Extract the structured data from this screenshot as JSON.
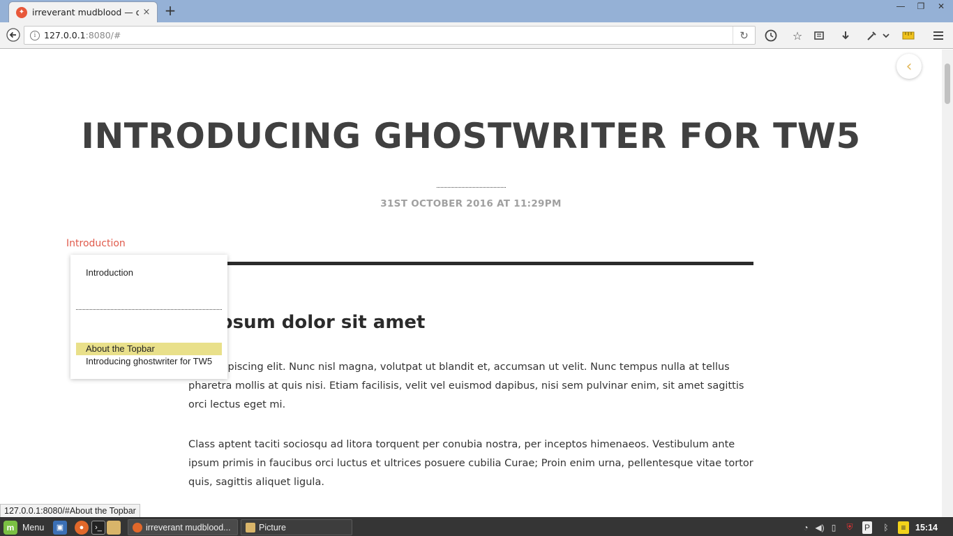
{
  "browser": {
    "tab_title": "irreverant mudblood — o...",
    "tab_close": "×",
    "new_tab": "+",
    "url_host": "127.0.0.1",
    "url_rest": ":8080/#",
    "info_glyph": "i"
  },
  "page": {
    "title": "INTRODUCING GHOSTWRITER FOR TW5",
    "date": "31ST OCTOBER 2016 AT 11:29PM",
    "toc_link": "Introduction",
    "heading": "m ipsum dolor sit amet",
    "para1": "etur adipiscing elit. Nunc nisl magna, volutpat ut blandit et, accumsan ut velit. Nunc tempus nulla at tellus pharetra mollis at quis nisi. Etiam facilisis, velit vel euismod dapibus, nisi sem pulvinar enim, sit amet sagittis orci lectus eget mi.",
    "para2": "Class aptent taciti sociosqu ad litora torquent per conubia nostra, per inceptos himenaeos. Vestibulum ante ipsum primis in faucibus orci luctus et ultrices posuere cubilia Curae; Proin enim urna, pellentesque vitae tortor quis, sagittis aliquet ligula."
  },
  "toc_popup": {
    "items": [
      "Introduction",
      "About the Topbar",
      "Introducing ghostwriter for TW5"
    ],
    "highlighted": "About the Topbar"
  },
  "status_url": "127.0.0.1:8080/#About the Topbar",
  "taskbar": {
    "menu_label": "Menu",
    "window1": "irreverant mudblood...",
    "window2": "Picture",
    "clock": "15:14"
  },
  "colors": {
    "tab_bar": "#95b1d6",
    "toc_link": "#e05a4b",
    "highlight": "#e9e08a",
    "title_text": "#404040"
  }
}
